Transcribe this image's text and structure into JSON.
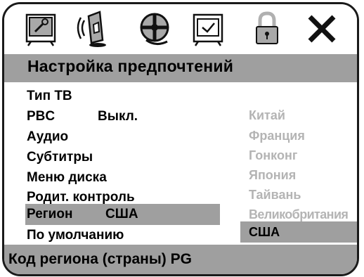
{
  "toolbar": {
    "icons": [
      {
        "name": "general-setup-icon"
      },
      {
        "name": "audio-setup-icon"
      },
      {
        "name": "video-setup-icon"
      },
      {
        "name": "preference-setup-icon"
      },
      {
        "name": "password-lock-icon"
      },
      {
        "name": "exit-icon"
      }
    ]
  },
  "title": "Настройка предпочтений",
  "menu": {
    "items": [
      {
        "label": "Тип ТВ",
        "value": ""
      },
      {
        "label": "PBC",
        "value": "Выкл."
      },
      {
        "label": "Аудио",
        "value": ""
      },
      {
        "label": "Субтитры",
        "value": ""
      },
      {
        "label": "Меню диска",
        "value": ""
      },
      {
        "label": "Родит. контроль",
        "value": ""
      },
      {
        "label": "Регион",
        "value": "США"
      },
      {
        "label": "По умолчанию",
        "value": ""
      }
    ],
    "selected_index": 6
  },
  "options": {
    "items": [
      "Китай",
      "Франция",
      "Гонконг",
      "Япония",
      "Тайвань",
      "Великобритания",
      "США"
    ],
    "selected_index": 6
  },
  "status": "Код региона (страны) PG",
  "colors": {
    "highlight": "#9f9f9f",
    "disabled_text": "#b4b4b4",
    "text": "#000000",
    "border": "#1a1a1a"
  }
}
